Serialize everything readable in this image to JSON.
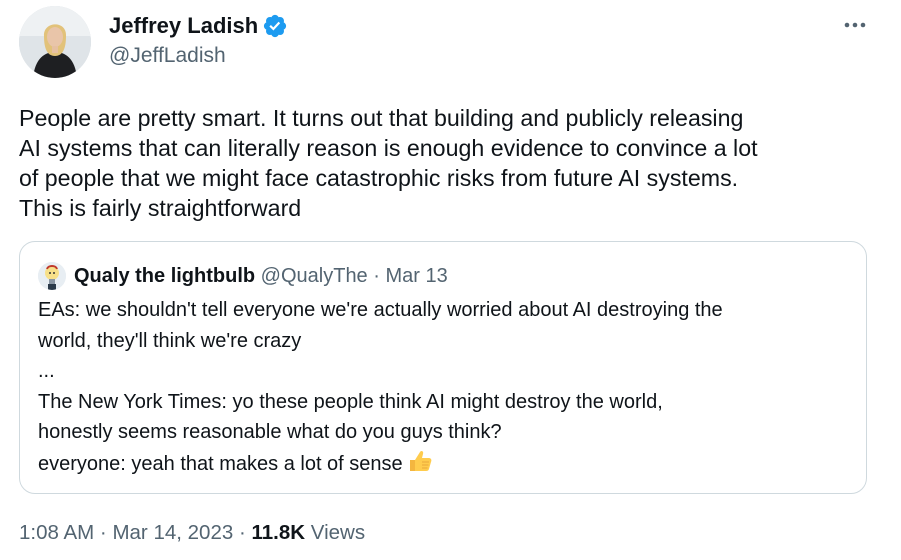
{
  "author": {
    "name": "Jeffrey Ladish",
    "handle": "@JeffLadish",
    "verified": true,
    "avatar_icon": "profile-photo"
  },
  "more_icon": "ellipsis-icon",
  "tweet": {
    "lines": [
      "People are pretty smart. It turns out that building and publicly releasing",
      "AI systems that can literally reason is enough evidence to convince a lot",
      "of people that we might face catastrophic risks from future AI systems.",
      "This is fairly straightforward"
    ]
  },
  "quote": {
    "name": "Qualy the lightbulb",
    "handle": "@QualyThe",
    "separator": "·",
    "date": "Mar 13",
    "avatar_icon": "lightbulb-icon",
    "lines": [
      "EAs: we shouldn't tell everyone we're actually worried about AI destroying the",
      "world, they'll think we're crazy",
      "...",
      "The New York Times: yo these people think AI might destroy the world,",
      "honestly seems reasonable what do you guys think?",
      "everyone: yeah that makes a lot of sense"
    ],
    "emoji": "thumbs-up-emoji"
  },
  "meta": {
    "time": "1:08 AM",
    "separator": "·",
    "date": "Mar 14, 2023",
    "views_count": "11.8K",
    "views_label": "Views"
  },
  "colors": {
    "text": "#0f1419",
    "secondary": "#536471",
    "verified": "#1d9bf0",
    "border": "#cfd9de"
  }
}
